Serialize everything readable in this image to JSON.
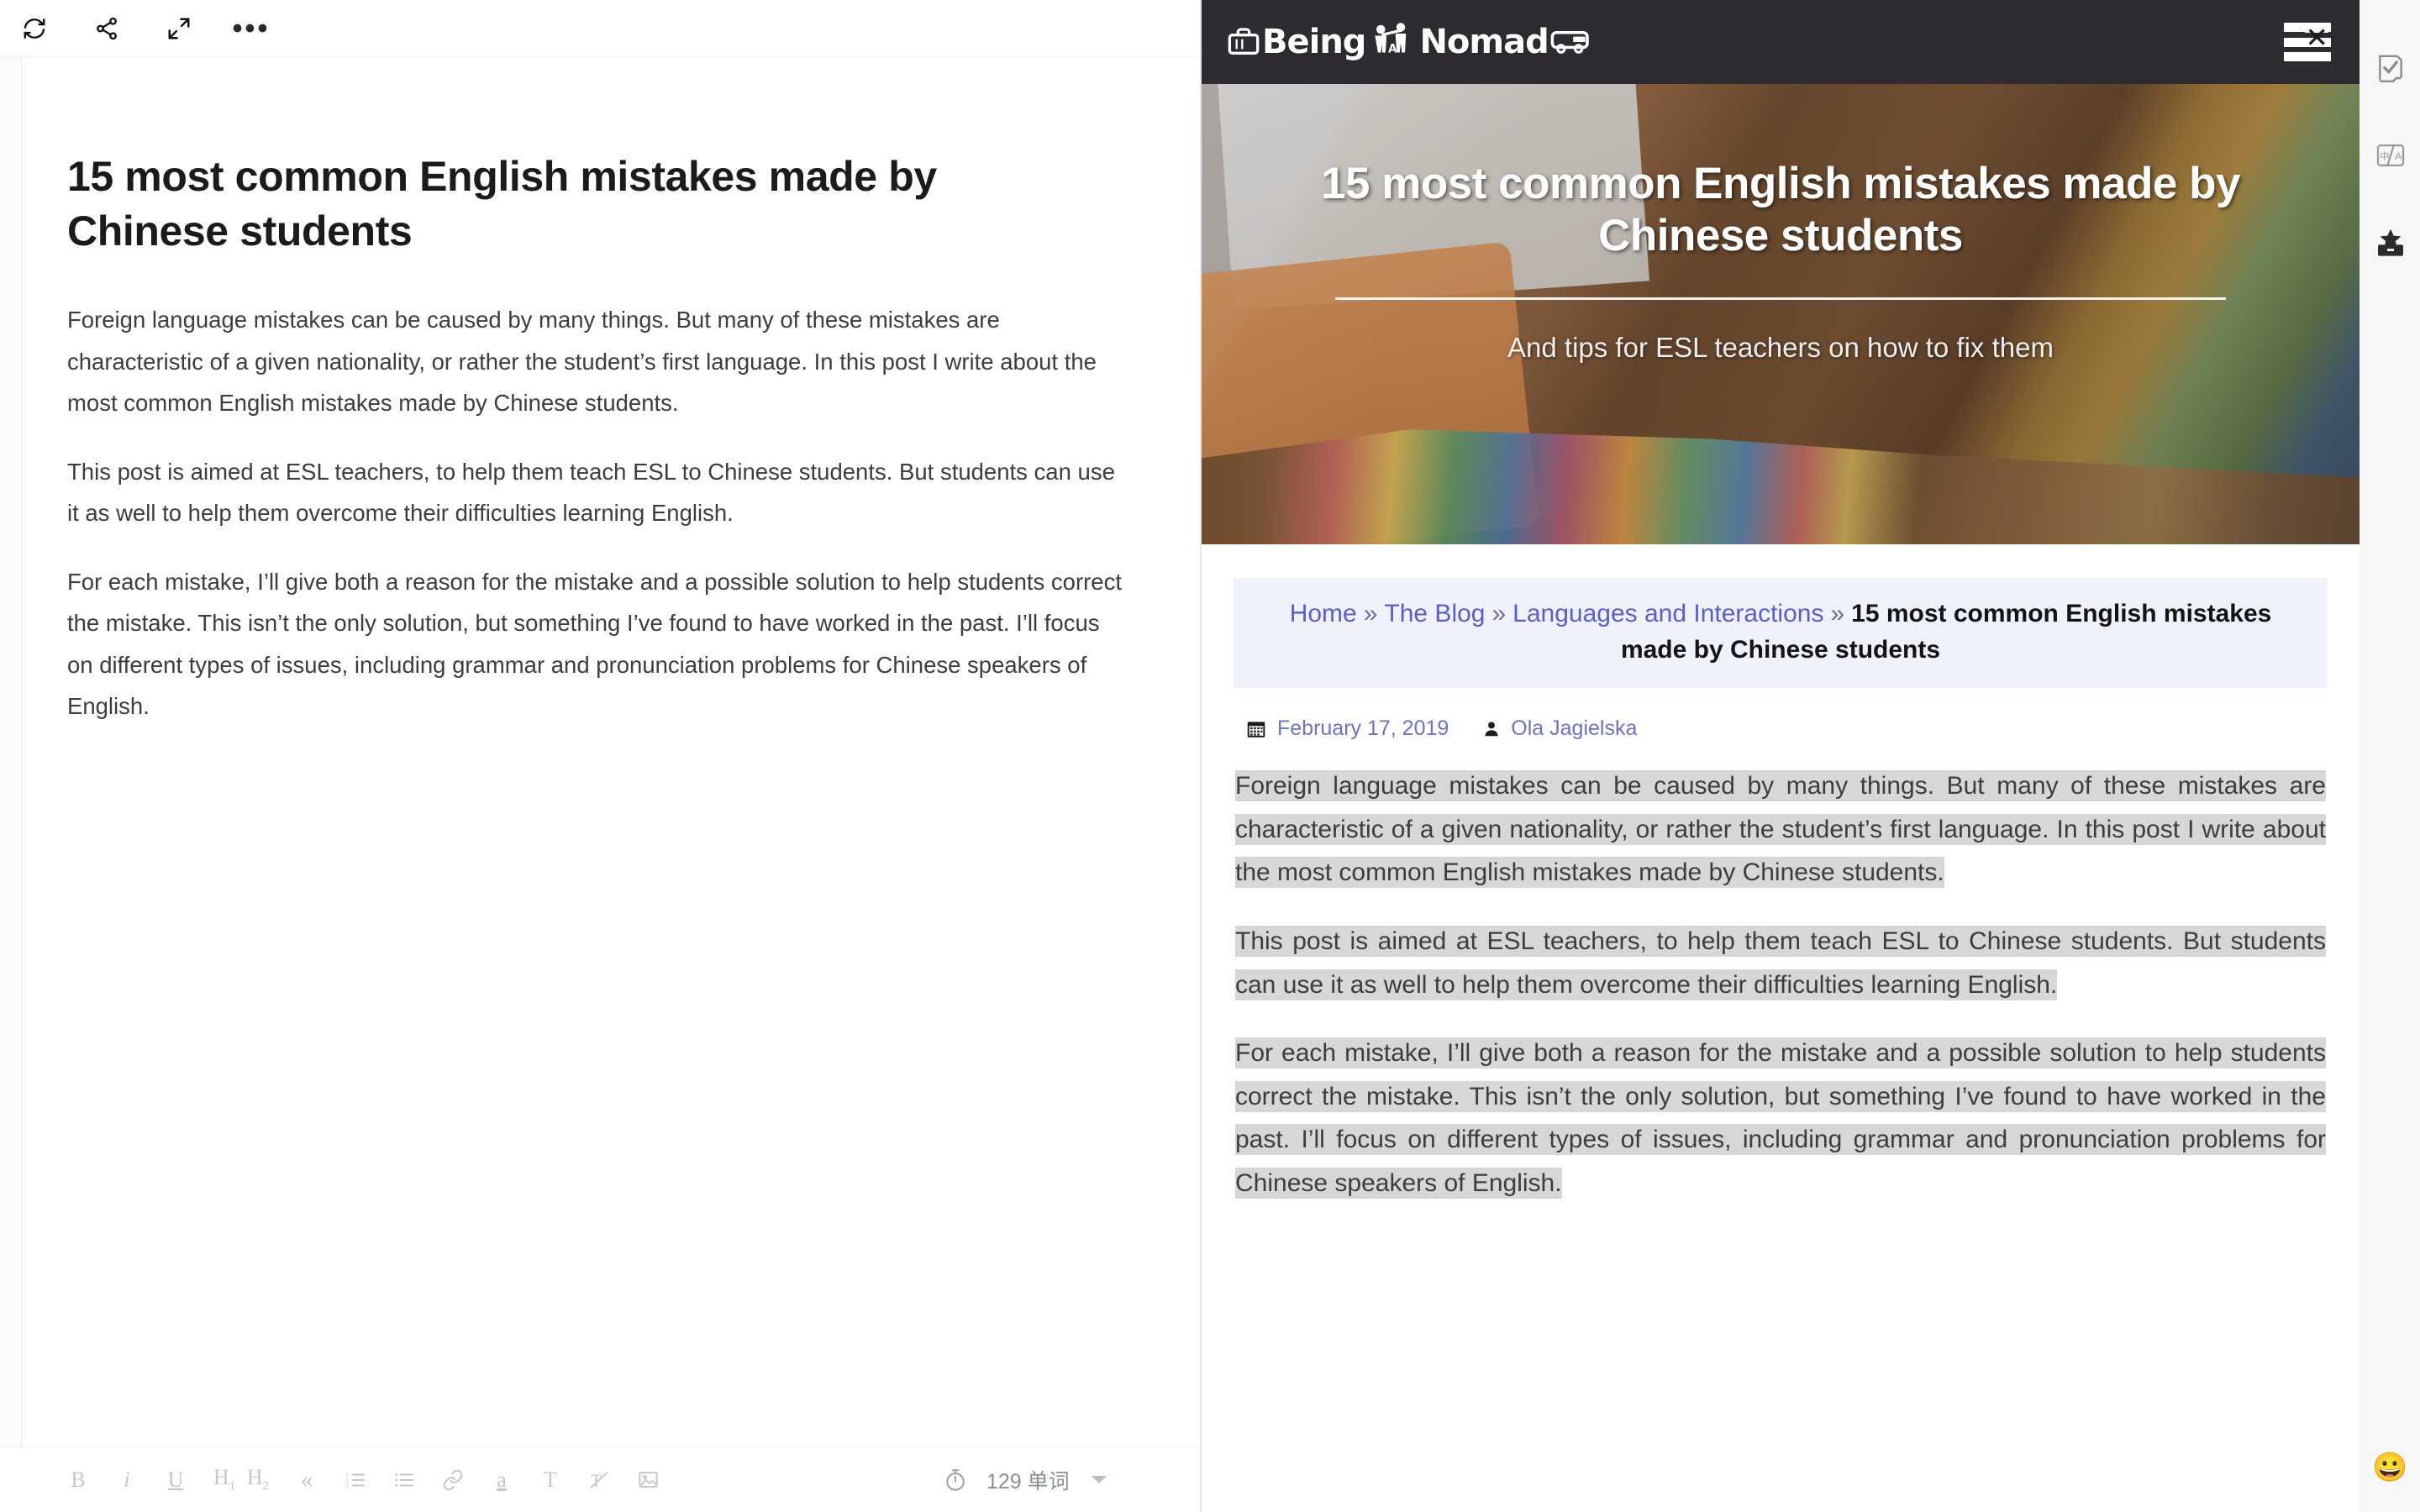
{
  "editor": {
    "toolbar": [
      {
        "name": "sync-icon",
        "label": "Sync"
      },
      {
        "name": "share-icon",
        "label": "Share"
      },
      {
        "name": "fullscreen-icon",
        "label": "Fullscreen"
      },
      {
        "name": "more-options-icon",
        "label": "More"
      }
    ],
    "document": {
      "title": "15 most common English mistakes made by Chinese students",
      "paragraphs": [
        "Foreign language mistakes can be caused by many things. But many of these mistakes are characteristic of a given nationality, or rather the student’s first language. In this post I write about the most common English mistakes made by Chinese students.",
        "This post is aimed at ESL teachers, to help them teach ESL to Chinese students. But students can use it as well to help them overcome their difficulties learning English.",
        "For each mistake, I’ll give both a reason for the mistake and a possible solution to help students correct the mistake. This isn’t the only solution, but something I’ve found to have worked in the past. I’ll focus on different types of issues, including grammar and pronunciation problems for Chinese speakers of English."
      ]
    },
    "format_bar": [
      {
        "name": "bold-button",
        "label": "B"
      },
      {
        "name": "italic-button",
        "label": "i"
      },
      {
        "name": "underline-button",
        "label": "U"
      },
      {
        "name": "heading-1-button",
        "label": "H1"
      },
      {
        "name": "heading-2-button",
        "label": "H2"
      },
      {
        "name": "blockquote-button",
        "label": "«"
      },
      {
        "name": "ordered-list-button",
        "label": "ordered-list"
      },
      {
        "name": "unordered-list-button",
        "label": "unordered-list"
      },
      {
        "name": "link-button",
        "label": "link"
      },
      {
        "name": "highlight-button",
        "label": "a"
      },
      {
        "name": "text-color-button",
        "label": "T"
      },
      {
        "name": "clear-format-button",
        "label": "clear-format"
      },
      {
        "name": "insert-image-button",
        "label": "image"
      }
    ],
    "status": {
      "timer_icon": "stopwatch-icon",
      "word_count": "129 单词"
    }
  },
  "preview": {
    "site": {
      "logo_prefix": "Being",
      "logo_middle": "A",
      "logo_suffix": "Nomad",
      "menu_label": "Menu"
    },
    "hero": {
      "title": "15 most common English mistakes made by Chinese students",
      "subtitle": "And tips for ESL teachers on how to fix them"
    },
    "breadcrumb": {
      "items": [
        {
          "label": "Home",
          "link": true
        },
        {
          "label": "The Blog",
          "link": true
        },
        {
          "label": "Languages and Interactions",
          "link": true
        },
        {
          "label": "15 most common English mistakes made by Chinese students",
          "link": false
        }
      ],
      "separator": "»"
    },
    "meta": {
      "date_icon": "calendar-icon",
      "date": "February 17, 2019",
      "author_icon": "user-icon",
      "author": "Ola Jagielska"
    },
    "paragraphs": [
      "Foreign language mistakes can be caused by many things. But many of these mistakes are characteristic of a given nationality, or rather the student’s first language. In this post I write about the most common English mistakes made by Chinese students.",
      "This post is aimed at ESL teachers, to help them teach ESL to Chinese students. But students can use it as well to help them overcome their difficulties learning English.",
      "For each mistake, I’ll give both a reason for the mistake and a possible solution to help students correct the mistake. This isn’t the only solution, but something I’ve found to have worked in the past. I’ll focus on different types of issues, including grammar and pronunciation problems for Chinese speakers of English."
    ]
  },
  "right_rail": {
    "items": [
      {
        "name": "proofread-icon",
        "label": "Proofread"
      },
      {
        "name": "translate-icon",
        "label": "Translate"
      },
      {
        "name": "toolbox-icon",
        "label": "Toolbox"
      }
    ],
    "emoji": "😀"
  },
  "colors": {
    "header_bg": "#2e2b31",
    "breadcrumb_bg": "#eff2fb",
    "link": "#5a5fc7",
    "highlight": "#d7d7d7",
    "rail_bg": "#f7f7f7"
  }
}
